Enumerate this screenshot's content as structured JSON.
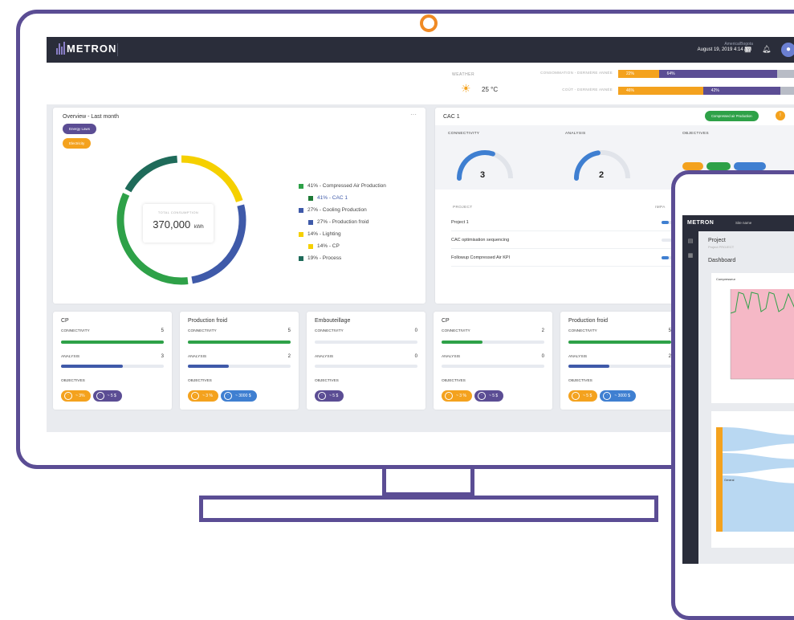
{
  "app": {
    "brand": "METRON",
    "timezone": "America/Bogota",
    "datetime": "August 19, 2019 4:14 AM"
  },
  "header": {
    "weather_label": "WEATHER",
    "temperature": "25 °C",
    "bars": [
      {
        "label": "CONSOMMATION - DERNIÈRE ANNÉE",
        "segments": [
          {
            "text": "22%",
            "color": "#f4a21e",
            "fraction": 0.22
          },
          {
            "text": "64%",
            "color": "#5b4d94",
            "fraction": 0.64
          }
        ]
      },
      {
        "label": "COÛT - DERNIÈRE ANNÉE",
        "segments": [
          {
            "text": "46%",
            "color": "#f4a21e",
            "fraction": 0.46
          },
          {
            "text": "42%",
            "color": "#5b4d94",
            "fraction": 0.42
          }
        ]
      }
    ]
  },
  "overview": {
    "title": "Overview - Last month",
    "menu": "···",
    "filters": [
      {
        "label": "Energy Laws",
        "color": "#5b4d94"
      },
      {
        "label": "Electricity",
        "color": "#f4a21e"
      }
    ],
    "center_label": "TOTAL CONSUMPTION",
    "center_value": "370,000",
    "center_unit": "kWh",
    "legend": [
      {
        "text": "41% - Compressed Air Production",
        "color": "#2ea148",
        "indent": false
      },
      {
        "text": "41% - CAC 1",
        "color": "#1e7a36",
        "indent": true
      },
      {
        "text": "27% - Cooling Production",
        "color": "#3f5aa9",
        "indent": false
      },
      {
        "text": "27% - Production froid",
        "color": "#3f5aa9",
        "indent": true
      },
      {
        "text": "14% - Lighting",
        "color": "#f5d000",
        "indent": false
      },
      {
        "text": "14% - CP",
        "color": "#f5d000",
        "indent": true
      },
      {
        "text": "19% - Process",
        "color": "#1f6b5a",
        "indent": false
      }
    ]
  },
  "cac": {
    "title": "CAC 1",
    "badge": "Compressed air Production",
    "columns": [
      "CONNECTIVITY",
      "ANALYSIS",
      "OBJECTIVES"
    ],
    "gauges": [
      {
        "value": "3",
        "fraction": 0.6
      },
      {
        "value": "2",
        "fraction": 0.45
      }
    ],
    "project_header": "PROJECT",
    "impact_header": "IMPA",
    "projects": [
      "Project 1",
      "CAC optimisation sequencing",
      "Followup Compressed Air KPI"
    ],
    "project_progress": [
      0.3,
      0.0,
      0.3
    ]
  },
  "mini_cards": [
    {
      "title": "CP",
      "connectivity": "5",
      "conn_fill": 1.0,
      "analysis": "3",
      "ana_fill": 0.6,
      "analysis_color": "#3f5aa9",
      "objectives": [
        {
          "text": "~ 3%",
          "color": "#f4a21e"
        },
        {
          "text": "~ 5 $",
          "color": "#5b4d94"
        }
      ]
    },
    {
      "title": "Production froid",
      "connectivity": "5",
      "conn_fill": 1.0,
      "analysis": "2",
      "ana_fill": 0.4,
      "analysis_color": "#3f5aa9",
      "objectives": [
        {
          "text": "~ 3 %",
          "color": "#f4a21e"
        },
        {
          "text": "~ 3000 $",
          "color": "#3f7fd1"
        }
      ]
    },
    {
      "title": "Embouteillage",
      "connectivity": "0",
      "conn_fill": 0.0,
      "analysis": "0",
      "ana_fill": 0.0,
      "analysis_color": "#3f5aa9",
      "objectives": [
        {
          "text": "~ 5 $",
          "color": "#5b4d94"
        }
      ]
    },
    {
      "title": "CP",
      "connectivity": "2",
      "conn_fill": 0.4,
      "analysis": "0",
      "ana_fill": 0.0,
      "analysis_color": "#3f5aa9",
      "objectives": [
        {
          "text": "~ 3 %",
          "color": "#f4a21e"
        },
        {
          "text": "~ 5 $",
          "color": "#5b4d94"
        }
      ]
    },
    {
      "title": "Production froid",
      "connectivity": "5",
      "conn_fill": 1.0,
      "analysis": "2",
      "ana_fill": 0.4,
      "analysis_color": "#3f5aa9",
      "objectives": [
        {
          "text": "~ 5 $",
          "color": "#f4a21e"
        },
        {
          "text": "~ 3000 $",
          "color": "#3f7fd1"
        }
      ]
    }
  ],
  "labels": {
    "connectivity": "CONNECTIVITY",
    "analysis": "ANALYSIS",
    "objectives": "OBJECTIVES"
  },
  "tablet": {
    "brand": "METRON",
    "site": "Site name",
    "project": "Project",
    "project_sub": "Project PROJECT",
    "dashboard": "Dashboard",
    "chart_title": "Compresseur",
    "sankey_left": "General"
  },
  "colors": {
    "accent": "#5b4d94",
    "orange": "#f4a21e",
    "green": "#2ea148",
    "blue": "#3f5aa9",
    "dark": "#2a2d3a"
  }
}
